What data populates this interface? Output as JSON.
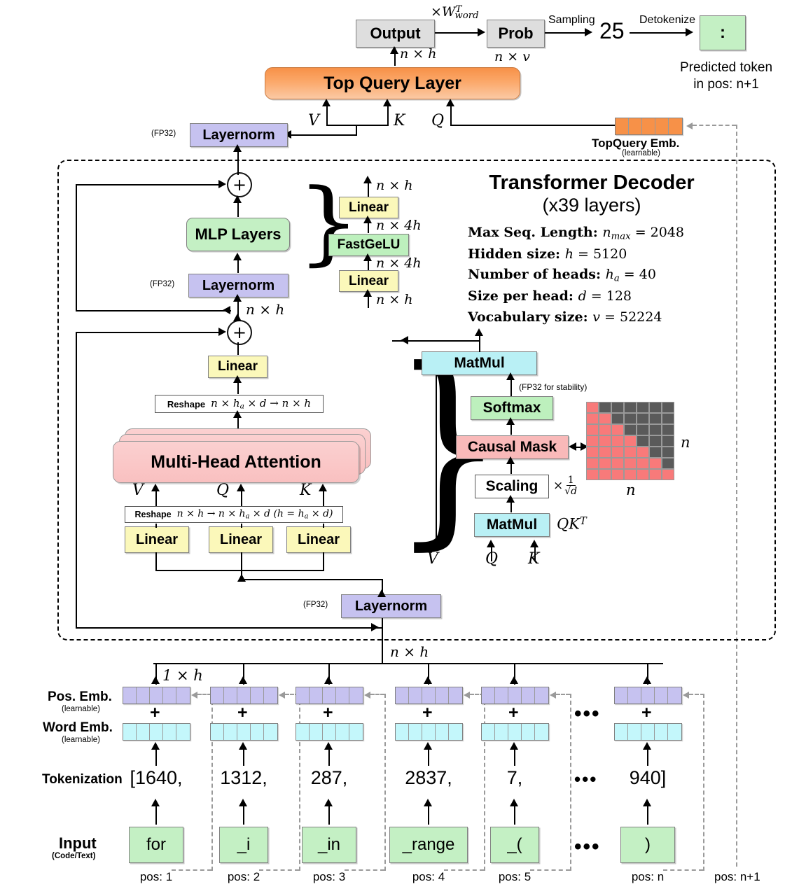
{
  "title": "Transformer Decoder Architecture Diagram",
  "output_head": {
    "output_label": "Output",
    "output_dim": "n × h",
    "w_word_label": "×W",
    "w_word_sub": "word",
    "w_word_sup": "T",
    "prob_label": "Prob",
    "prob_dim": "n × v",
    "sampling_label": "Sampling",
    "sampled_token_id": "25",
    "detokenize_label": "Detokenize",
    "predicted_token": ":",
    "predicted_caption_line1": "Predicted token",
    "predicted_caption_line2": "in pos: n+1"
  },
  "top_query": {
    "layer_label": "Top Query Layer",
    "v_label": "V",
    "k_label": "K",
    "q_label": "Q",
    "layernorm_label": "Layernorm",
    "fp32_label": "(FP32)",
    "emb_label": "TopQuery Emb.",
    "emb_sub": "(learnable)"
  },
  "decoder": {
    "title_line1": "Transformer Decoder",
    "title_line2": "(x39 layers)",
    "specs": [
      {
        "name": "Max Seq. Length:",
        "sym": "n",
        "sub": "max",
        "value": "2048"
      },
      {
        "name": "Hidden size:",
        "sym": "h",
        "sub": "",
        "value": "5120"
      },
      {
        "name": "Number of heads:",
        "sym": "h",
        "sub": "a",
        "value": "40"
      },
      {
        "name": "Size per head:",
        "sym": "d",
        "sub": "",
        "value": "128"
      },
      {
        "name": "Vocabulary size:",
        "sym": "v",
        "sub": "",
        "value": "52224"
      }
    ]
  },
  "mlp_block": {
    "mlp_label": "MLP Layers",
    "layernorm_label": "Layernorm",
    "fp32_label": "(FP32)",
    "residual_dim": "n × h",
    "expand": {
      "linear_top": "Linear",
      "act": "FastGeLU",
      "linear_bottom": "Linear",
      "dim_top": "n × h",
      "dim_mid_upper": "n × 4h",
      "dim_mid_lower": "n × 4h",
      "dim_bottom": "n × h"
    }
  },
  "attention_block": {
    "out_linear": "Linear",
    "reshape_out": "Reshape",
    "reshape_out_math": "n × h_a × d → n × h",
    "mha_label": "Multi-Head Attention",
    "v_label": "V",
    "q_label": "Q",
    "k_label": "K",
    "reshape_in": "Reshape",
    "reshape_in_math": "n × h → n × h_a × d  (h = h_a × d)",
    "linear_v": "Linear",
    "linear_q": "Linear",
    "linear_k": "Linear",
    "layernorm_label": "Layernorm",
    "fp32_label": "(FP32)",
    "input_dim": "n × h"
  },
  "attention_detail": {
    "matmul_top": "MatMul",
    "softmax": "Softmax",
    "fp32_note": "(FP32 for stability)",
    "causal_mask": "Causal Mask",
    "scaling": "Scaling",
    "scaling_math": "× 1/√d",
    "matmul_bottom": "MatMul",
    "qkt": "QK",
    "qkt_sup": "T",
    "v_label": "V",
    "q_label": "Q",
    "k_label": "K",
    "mask_dim_right": "n",
    "mask_dim_bottom": "n",
    "mask_size": 7
  },
  "embedding": {
    "pos_emb_label": "Pos. Emb.",
    "pos_emb_sub": "(learnable)",
    "word_emb_label": "Word Emb.",
    "word_emb_sub": "(learnable)",
    "plus": "+",
    "tokenization_label": "Tokenization",
    "input_label": "Input",
    "input_sub": "(Code/Text)",
    "seq_dim": "n × h",
    "single_dim": "1 × h",
    "ellipsis": "...",
    "columns": [
      {
        "token": "for",
        "token_id": "[1640,",
        "pos": "pos: 1",
        "cells": 5
      },
      {
        "token": "_i",
        "token_id": "1312,",
        "pos": "pos: 2",
        "cells": 5
      },
      {
        "token": "_in",
        "token_id": "287,",
        "pos": "pos: 3",
        "cells": 5
      },
      {
        "token": "_range",
        "token_id": "2837,",
        "pos": "pos: 4",
        "cells": 5
      },
      {
        "token": "_(",
        "token_id": "7,",
        "pos": "pos: 5",
        "cells": 5
      },
      {
        "token": ")",
        "token_id": "940]",
        "pos": "pos: n",
        "cells": 5
      }
    ],
    "next_pos": "pos: n+1"
  },
  "colors": {
    "gray_box": "#dedede",
    "green_box": "#c4f0c4",
    "yellow_box": "#fbf8ba",
    "purple_box": "#c6c2f0",
    "cyan_box": "#b9f0f5",
    "pink_box": "#f9b9b9",
    "orange_gradient_top": "#f79148",
    "orange_gradient_bottom": "#fbc9a4",
    "mask_active": "#f87a7a",
    "mask_masked": "#5a5a5a",
    "pos_emb_cell": "#c6c2f0",
    "word_emb_cell": "#c4f7fb"
  }
}
